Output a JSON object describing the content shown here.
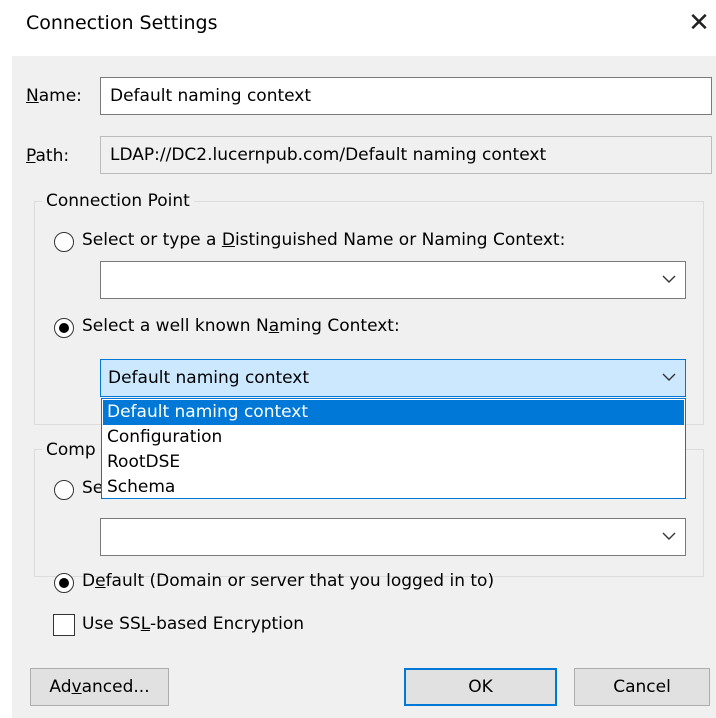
{
  "window": {
    "title": "Connection Settings",
    "close_glyph": "✕"
  },
  "name_field": {
    "label_pre": "",
    "label_accel": "N",
    "label_post": "ame:",
    "value": "Default naming context"
  },
  "path_field": {
    "label_pre": "",
    "label_accel": "P",
    "label_post": "ath:",
    "value": "LDAP://DC2.lucernpub.com/Default naming context"
  },
  "connection_point": {
    "group_title": "Connection Point",
    "dn_option": {
      "label_pre": "Select or type a ",
      "label_accel": "D",
      "label_post": "istinguished Name or Naming Context:",
      "selected": false
    },
    "dn_combo_value": "",
    "well_known_option": {
      "label_pre": "Select a well known N",
      "label_accel": "a",
      "label_post": "ming Context:",
      "selected": true
    },
    "well_known_combo_value": "Default naming context",
    "dropdown_options": [
      "Default naming context",
      "Configuration",
      "RootDSE",
      "Schema"
    ],
    "highlighted_index": 0
  },
  "computer": {
    "group_title_partial": "Comp",
    "select_option_partial": "Se",
    "combo_value": "",
    "default_option": {
      "label_pre": "D",
      "label_accel": "e",
      "label_post": "fault (Domain or server that you logged in to)",
      "selected": true
    }
  },
  "ssl": {
    "label_pre": "Use SS",
    "label_accel": "L",
    "label_post": "-based Encryption",
    "checked": false
  },
  "buttons": {
    "advanced": {
      "pre": "Ad",
      "accel": "v",
      "post": "anced..."
    },
    "ok": "OK",
    "cancel": "Cancel"
  },
  "icons": {
    "chevron": "chevron-down-icon",
    "radio": "radio-button",
    "close": "close-icon"
  },
  "colors": {
    "accent": "#0078d7",
    "selection_bg": "#cce8ff",
    "dialog_bg": "#f0f0f0"
  }
}
